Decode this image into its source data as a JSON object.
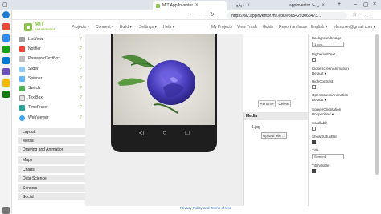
{
  "browser": {
    "tabs": [
      {
        "label": "MIT App Inventor",
        "active": true
      },
      {
        "label": "موقع",
        "active": false
      },
      {
        "label": "appinventor رابط",
        "active": false
      }
    ],
    "url": "https://ai2.appinventor.mit.edu/#5654293066473... "
  },
  "app": {
    "logo_top": "MIT",
    "logo_bottom": "APP INVENTOR",
    "menu": [
      "Projects ▾",
      "Connect ▾",
      "Build ▾",
      "Settings ▾",
      "Help ▾"
    ],
    "right_menu": [
      "My Projects",
      "View Trash",
      "Guide",
      "Report an Issue",
      "English ▾",
      "elcmoser@gmail.com ▾"
    ]
  },
  "palette": {
    "items": [
      "ListView",
      "Notifier",
      "PasswordTextBox",
      "Slider",
      "Spinner",
      "Switch",
      "TextBox",
      "TimePicker",
      "WebViewer"
    ],
    "categories": [
      "Layout",
      "Media",
      "Drawing and Animation",
      "Maps",
      "Charts",
      "Data Science",
      "Sensors",
      "Social"
    ]
  },
  "viewer": {
    "rename_label": "Rename",
    "delete_label": "Delete"
  },
  "media": {
    "title": "Media",
    "file": "1.jpg",
    "upload_label": "Upload File ..."
  },
  "properties": {
    "background_image_label": "BackgroundImage",
    "background_image_value": "1.jpg...",
    "big_default_text_label": "BigDefaultText",
    "close_screen_animation_label": "CloseScreenAnimation",
    "close_screen_animation_value": "Default ▾",
    "high_contrast_label": "HighContrast",
    "open_screen_animation_label": "OpenScreenAnimation",
    "open_screen_animation_value": "Default ▾",
    "screen_orientation_label": "ScreenOrientation",
    "screen_orientation_value": "Unspecified ▾",
    "scrollable_label": "Scrollable",
    "show_status_bar_label": "ShowStatusBar",
    "title_label": "Title",
    "title_value": "Screen1",
    "title_visible_label": "TitleVisible"
  },
  "footer": "Privacy Policy and Terms of Use",
  "colors": {
    "accent": "#8bc34a",
    "header_bg": "#ffffff",
    "rose": "#4a3fbf"
  }
}
